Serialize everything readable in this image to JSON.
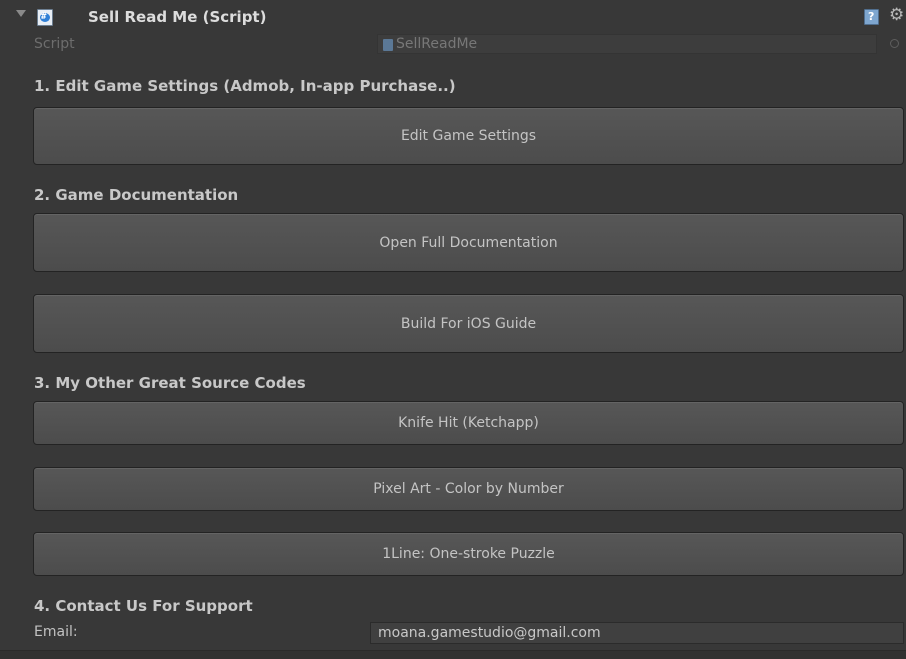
{
  "component": {
    "title": "Sell Read Me (Script)",
    "script_icon_glyph": "#",
    "help_glyph": "?",
    "gear_glyph": "⚙"
  },
  "script_field": {
    "label": "Script",
    "value": "SellReadMe"
  },
  "sections": {
    "settings": {
      "heading": "1. Edit Game Settings (Admob, In-app Purchase..)",
      "button": "Edit Game Settings"
    },
    "docs": {
      "heading": "2. Game Documentation",
      "buttons": [
        "Open Full Documentation",
        "Build For iOS Guide"
      ]
    },
    "sources": {
      "heading": "3. My Other Great Source Codes",
      "buttons": [
        "Knife Hit (Ketchapp)",
        "Pixel Art - Color by Number",
        "1Line: One-stroke Puzzle"
      ]
    },
    "contact": {
      "heading": "4. Contact Us For Support",
      "email_label": "Email:",
      "email_value": "moana.gamestudio@gmail.com"
    }
  },
  "icons": {
    "foldout": "foldout-arrow-icon",
    "script": "csharp-script-icon",
    "help": "help-book-icon",
    "settings": "gear-icon",
    "file": "script-file-icon",
    "picker": "object-picker-icon"
  },
  "colors": {
    "background": "#383838",
    "button": "#555555",
    "text": "#c2c2c2",
    "script_blue": "#2f7fd6"
  }
}
